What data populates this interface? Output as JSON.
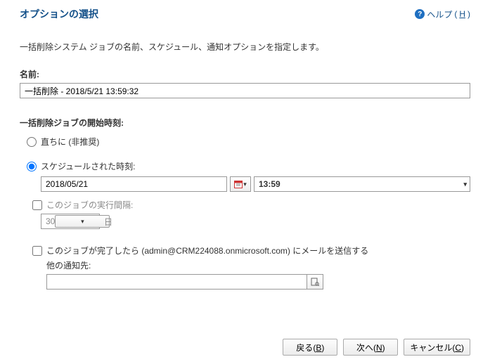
{
  "header": {
    "title": "オプションの選択",
    "help_label": "ヘルプ",
    "help_key": "H"
  },
  "intro": "一括削除システム ジョブの名前、スケジュール、通知オプションを指定します。",
  "name": {
    "label": "名前:",
    "value": "一括削除 - 2018/5/21 13:59:32"
  },
  "start_time": {
    "label": "一括削除ジョブの開始時刻:",
    "immediate_label": "直ちに (非推奨)",
    "scheduled_label": "スケジュールされた時刻:",
    "date_value": "2018/05/21",
    "time_value": "13:59",
    "interval_checkbox_label": "このジョブの実行間隔:",
    "interval_value": "30",
    "interval_unit": "日"
  },
  "notify": {
    "checkbox_label": "このジョブが完了したら (admin@CRM224088.onmicrosoft.com) にメールを送信する",
    "other_label": "他の通知先:",
    "lookup_value": ""
  },
  "footer": {
    "back_label": "戻る",
    "back_key": "B",
    "next_label": "次へ",
    "next_key": "N",
    "cancel_label": "キャンセル",
    "cancel_key": "C"
  }
}
